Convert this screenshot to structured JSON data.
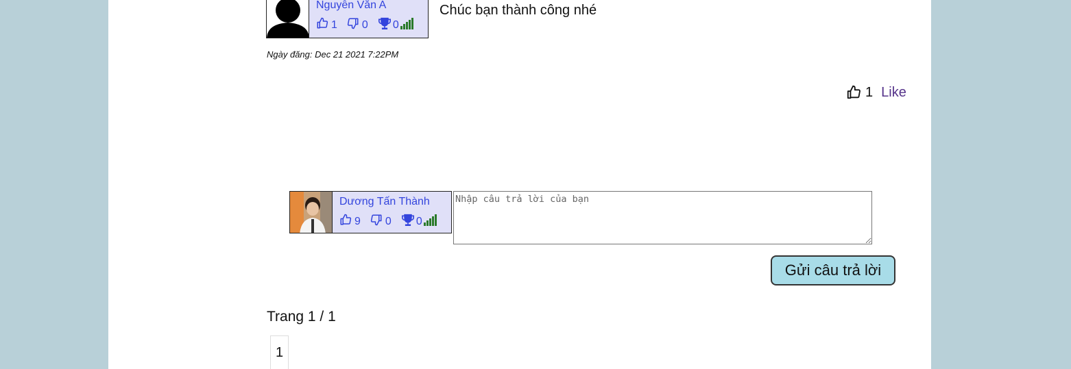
{
  "comment": {
    "author": {
      "name": "Nguyễn Văn A",
      "likes": "1",
      "dislikes": "0",
      "trophies": "0"
    },
    "text": "Chúc bạn thành công nhé",
    "date": "Ngày đăng: Dec 21 2021 7:22PM",
    "like_count": "1",
    "like_label": "Like"
  },
  "reply_box": {
    "user": {
      "name": "Dương Tấn Thành",
      "likes": "9",
      "dislikes": "0",
      "trophies": "0"
    },
    "placeholder": "Nhập câu trả lời của bạn",
    "submit_label": "Gửi câu trả lời"
  },
  "pagination": {
    "label": "Trang 1 / 1",
    "pages": [
      "1"
    ]
  },
  "colors": {
    "background": "#b8d0d8",
    "card_bg": "#e0e0f8",
    "link_blue": "#3344dd",
    "button_bg": "#a8dce8",
    "signal_green": "#2a7a2a"
  }
}
